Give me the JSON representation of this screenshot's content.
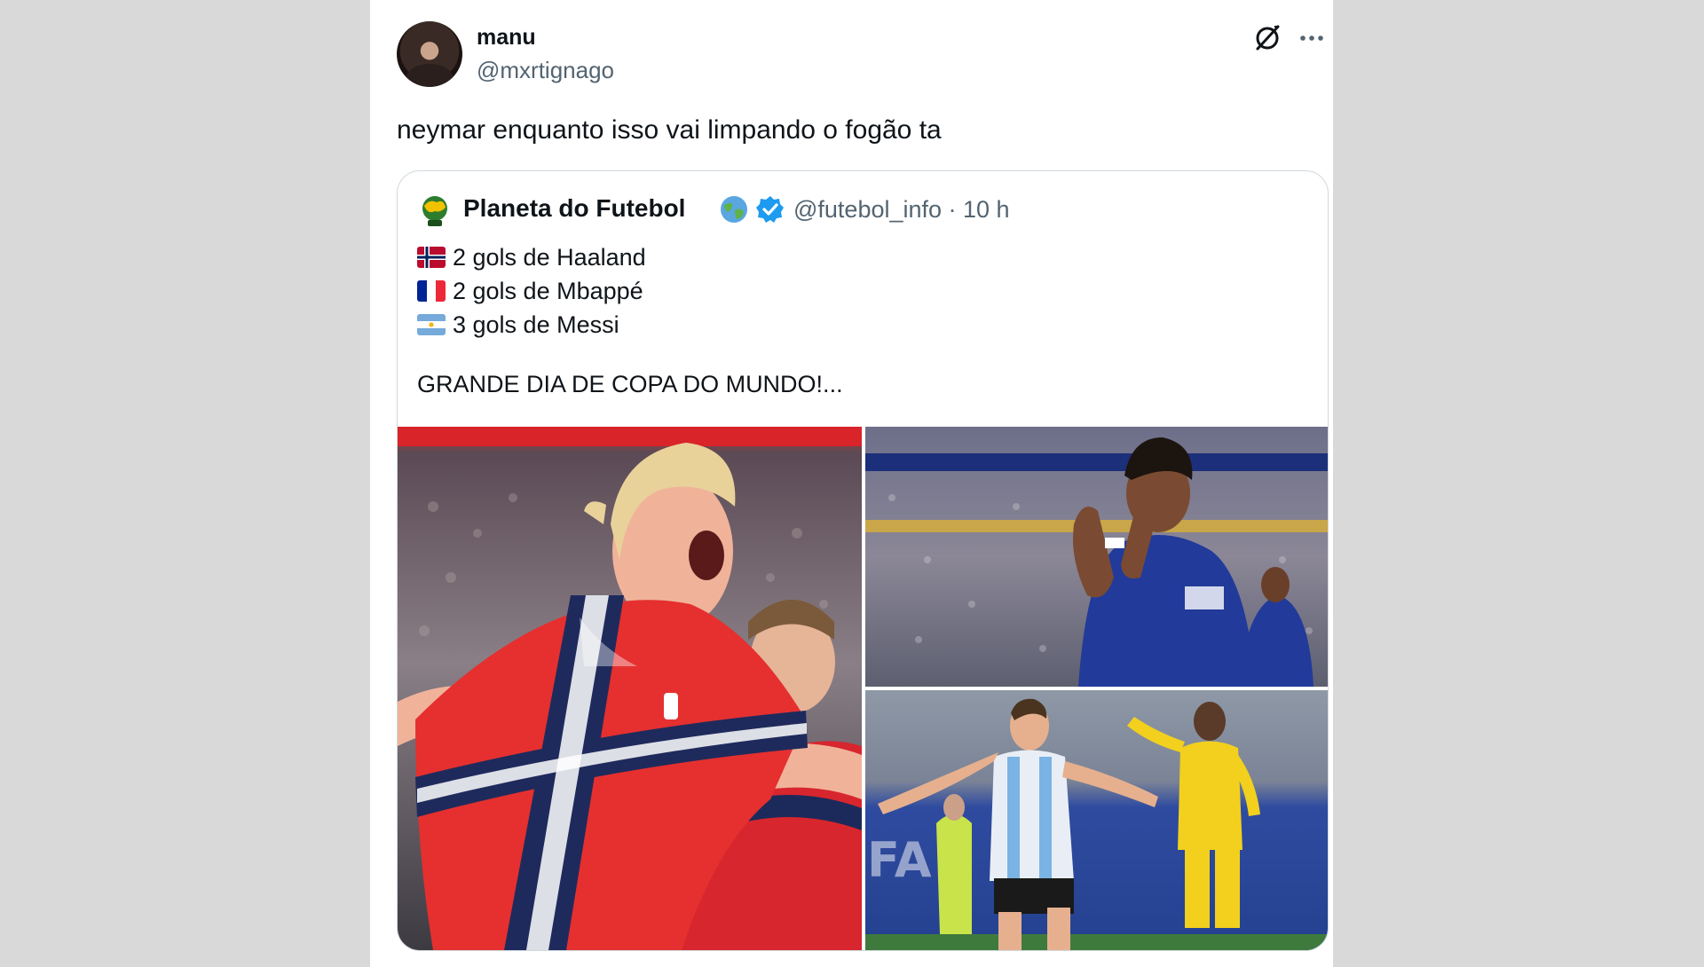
{
  "tweet": {
    "author_name": "manu",
    "author_handle": "@mxrtignago",
    "text": "neymar enquanto isso vai limpando o fogão ta"
  },
  "quote": {
    "name": "Planeta do Futebol",
    "handle_time": "@futebol_info · 10 h",
    "lines": [
      {
        "flag": "norway-flag",
        "text": "2 gols de Haaland"
      },
      {
        "flag": "france-flag",
        "text": "2 gols de Mbappé"
      },
      {
        "flag": "argentina-flag",
        "text": "3 gols de Messi"
      }
    ],
    "headline": "GRANDE DIA DE COPA DO MUNDO!..."
  },
  "icons": {
    "grok": "grok-icon",
    "more": "more-options-icon",
    "globe": "globe-emoji-icon",
    "verified": "verified-badge-icon"
  },
  "colors": {
    "page_background": "#d9d9d9",
    "card_background": "#ffffff",
    "text_primary": "#0f1419",
    "text_secondary": "#536471",
    "verified_blue": "#1d9bf0",
    "border": "#cfd9de"
  }
}
